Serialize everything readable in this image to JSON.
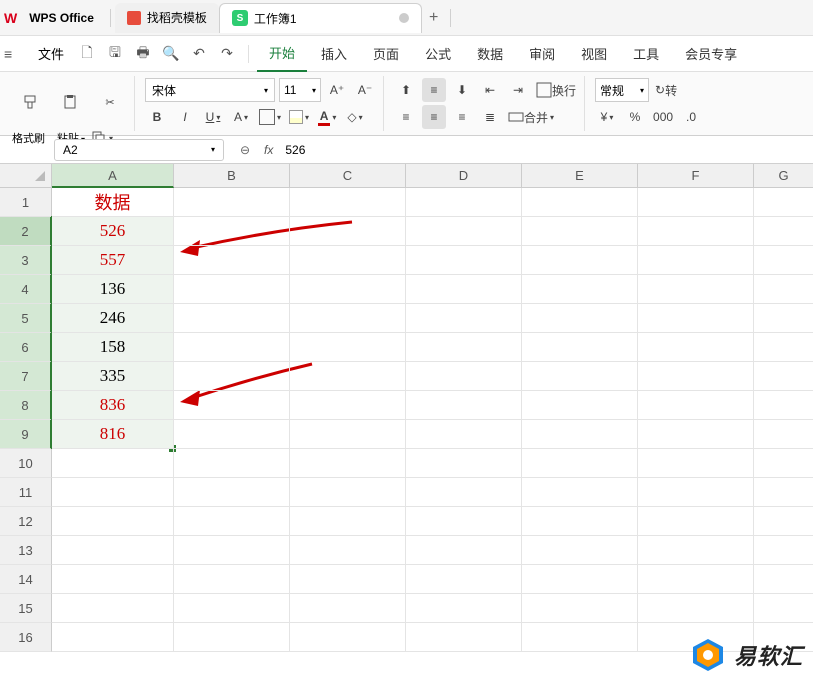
{
  "titlebar": {
    "app": "WPS Office",
    "template_tab": "找稻壳模板",
    "active_tab": "工作簿1",
    "doc_badge": "S",
    "add": "+"
  },
  "menubar": {
    "file": "文件",
    "items": [
      "开始",
      "插入",
      "页面",
      "公式",
      "数据",
      "审阅",
      "视图",
      "工具",
      "会员专享"
    ]
  },
  "toolbar": {
    "format_painter": "格式刷",
    "paste": "粘贴",
    "font_name": "宋体",
    "font_size": "11",
    "bold": "B",
    "italic": "I",
    "underline": "U",
    "font_a": "A",
    "wrap": "换行",
    "merge": "合并",
    "format": "常规",
    "convert": "转",
    "currency": "¥",
    "percent": "%"
  },
  "namebox": {
    "ref": "A2",
    "formula": "526",
    "fx": "fx"
  },
  "columns": [
    "A",
    "B",
    "C",
    "D",
    "E",
    "F",
    "G"
  ],
  "rows": [
    "1",
    "2",
    "3",
    "4",
    "5",
    "6",
    "7",
    "8",
    "9",
    "10",
    "11",
    "12",
    "13",
    "14",
    "15",
    "16"
  ],
  "data": {
    "header": "数据",
    "values": [
      "526",
      "557",
      "136",
      "246",
      "158",
      "335",
      "836",
      "816"
    ],
    "red_rows": [
      0,
      1,
      6,
      7
    ]
  },
  "watermark": "易软汇"
}
